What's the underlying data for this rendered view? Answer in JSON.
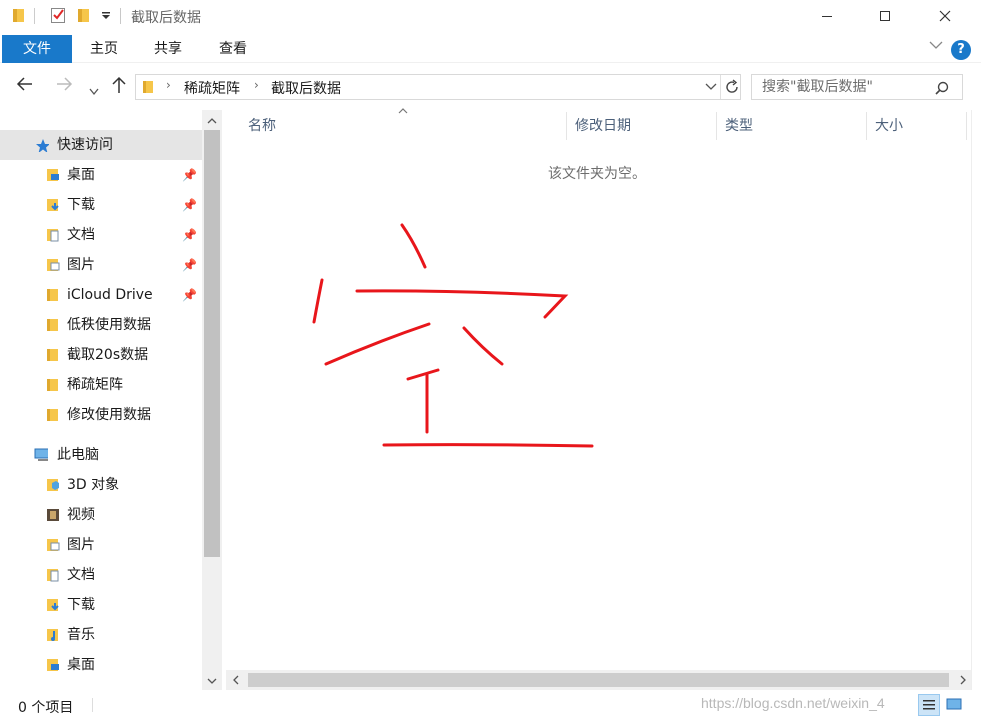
{
  "window": {
    "title": "截取后数据",
    "quick_access_toolbar": [
      "folder-icon",
      "properties-check-icon",
      "new-folder-icon",
      "customize-dropdown-icon"
    ],
    "controls": [
      "minimize",
      "maximize",
      "close"
    ]
  },
  "ribbon": {
    "tabs": [
      {
        "label": "文件",
        "active": true
      },
      {
        "label": "主页"
      },
      {
        "label": "共享"
      },
      {
        "label": "查看"
      }
    ],
    "help_label": "?"
  },
  "address": {
    "crumbs": [
      "稀疏矩阵",
      "截取后数据"
    ],
    "search_placeholder": "搜索\"截取后数据\""
  },
  "nav": {
    "quick_access_label": "快速访问",
    "quick_items": [
      {
        "label": "桌面",
        "icon": "desktop-folder-icon",
        "pinned": true
      },
      {
        "label": "下载",
        "icon": "downloads-folder-icon",
        "pinned": true
      },
      {
        "label": "文档",
        "icon": "documents-folder-icon",
        "pinned": true
      },
      {
        "label": "图片",
        "icon": "pictures-folder-icon",
        "pinned": true
      },
      {
        "label": "iCloud Drive",
        "icon": "folder-icon",
        "pinned": true
      },
      {
        "label": "低秩使用数据",
        "icon": "folder-icon",
        "pinned": false
      },
      {
        "label": "截取20s数据",
        "icon": "folder-icon",
        "pinned": false
      },
      {
        "label": "稀疏矩阵",
        "icon": "folder-icon",
        "pinned": false
      },
      {
        "label": "修改使用数据",
        "icon": "folder-icon",
        "pinned": false
      }
    ],
    "this_pc_label": "此电脑",
    "pc_items": [
      {
        "label": "3D 对象",
        "icon": "3d-objects-icon"
      },
      {
        "label": "视频",
        "icon": "videos-icon"
      },
      {
        "label": "图片",
        "icon": "pictures-folder-icon"
      },
      {
        "label": "文档",
        "icon": "documents-folder-icon"
      },
      {
        "label": "下载",
        "icon": "downloads-folder-icon"
      },
      {
        "label": "音乐",
        "icon": "music-icon"
      },
      {
        "label": "桌面",
        "icon": "desktop-folder-icon"
      }
    ]
  },
  "columns": [
    {
      "label": "名称"
    },
    {
      "label": "修改日期"
    },
    {
      "label": "类型"
    },
    {
      "label": "大小"
    }
  ],
  "content": {
    "empty_message": "该文件夹为空。",
    "annotation_color": "#e8161b"
  },
  "status": {
    "item_count": "0 个项目",
    "watermark": "https://blog.csdn.net/weixin_4"
  },
  "colors": {
    "accent": "#1979ca",
    "folder": "#f6c64a",
    "selected": "#e5e5e5"
  }
}
